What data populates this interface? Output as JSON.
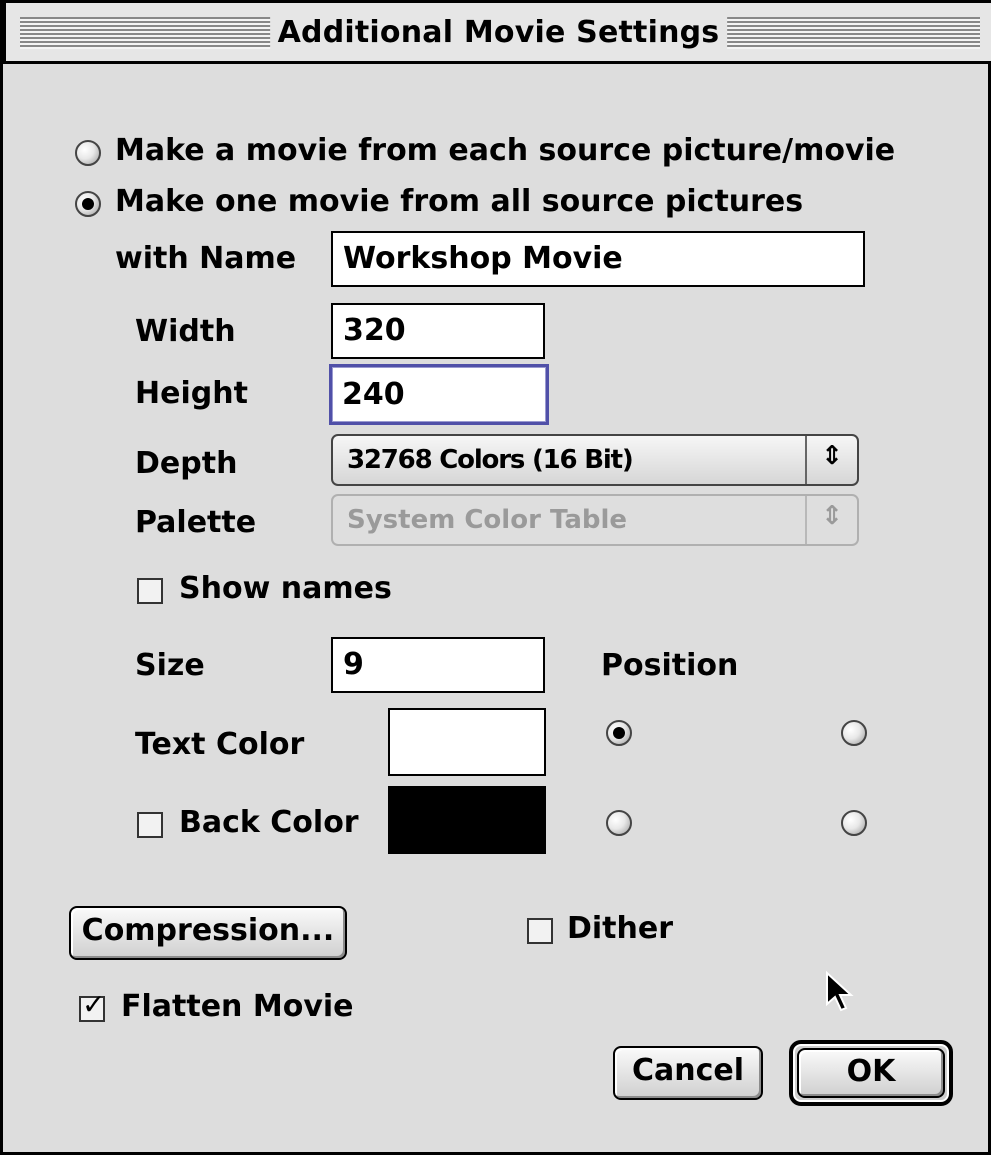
{
  "window": {
    "title": "Additional Movie Settings"
  },
  "mode_options": [
    {
      "label": "Make a movie from each source picture/movie",
      "selected": false
    },
    {
      "label": "Make one movie from all source pictures",
      "selected": true
    }
  ],
  "name_field": {
    "label": "with Name",
    "value": "Workshop Movie"
  },
  "width_field": {
    "label": "Width",
    "value": "320"
  },
  "height_field": {
    "label": "Height",
    "value": "240"
  },
  "depth_select": {
    "label": "Depth",
    "value": "32768 Colors (16 Bit)"
  },
  "palette_select": {
    "label": "Palette",
    "value": "System Color Table",
    "enabled": false
  },
  "show_names": {
    "label": "Show names",
    "checked": false
  },
  "size_field": {
    "label": "Size",
    "value": "9"
  },
  "position": {
    "label": "Position",
    "selected_index": 0
  },
  "text_color": {
    "label": "Text Color",
    "color": "#ffffff"
  },
  "back_color": {
    "label": "Back Color",
    "checked": false,
    "color": "#000000"
  },
  "compression_button": {
    "label": "Compression..."
  },
  "dither": {
    "label": "Dither",
    "checked": false
  },
  "flatten_movie": {
    "label": "Flatten Movie",
    "checked": true
  },
  "cancel_button": {
    "label": "Cancel"
  },
  "ok_button": {
    "label": "OK"
  }
}
